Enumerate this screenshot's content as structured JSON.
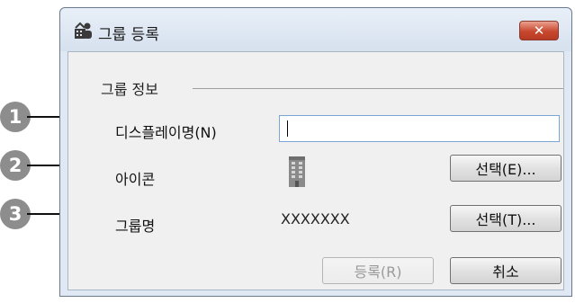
{
  "dialog": {
    "title": "그룹 등록",
    "close_label": "✕"
  },
  "group_info": {
    "label": "그룹 정보"
  },
  "fields": {
    "display_name_label": "디스플레이명(N)",
    "display_name_value": "",
    "icon_label": "아이콘",
    "group_name_label": "그룹명",
    "group_name_value": "XXXXXXX"
  },
  "buttons": {
    "select_icon": "선택(E)...",
    "select_group": "선택(T)...",
    "register": "등록(R)",
    "cancel": "취소"
  },
  "callouts": [
    "1",
    "2",
    "3"
  ],
  "icons": {
    "title": "group-register-icon",
    "field": "building-icon"
  }
}
